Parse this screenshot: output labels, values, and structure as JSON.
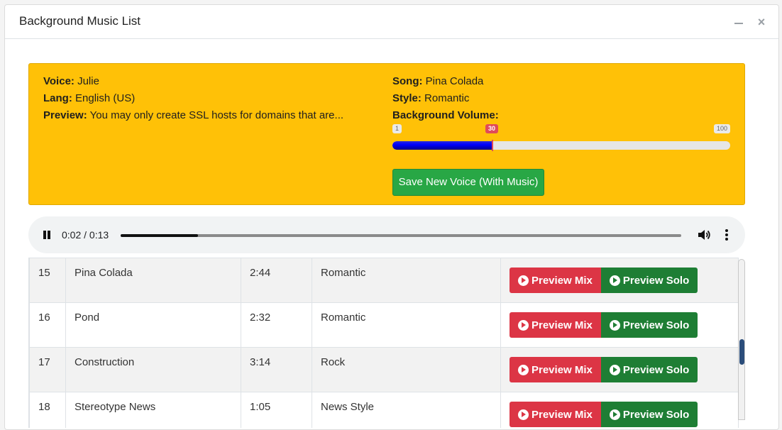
{
  "modal": {
    "title": "Background Music List",
    "close_glyph": "×"
  },
  "voice_info": {
    "voice_label": "Voice:",
    "voice": "Julie",
    "lang_label": "Lang:",
    "lang": "English (US)",
    "preview_label": "Preview:",
    "preview": "You may only create SSL hosts for domains that are..."
  },
  "song_info": {
    "song_label": "Song:",
    "song": "Pina Colada",
    "style_label": "Style:",
    "style": "Romantic",
    "volume_label": "Background Volume:"
  },
  "volume_slider": {
    "min": "1",
    "max": "100",
    "value": "30",
    "value_num": 30,
    "min_num": 1,
    "max_num": 100
  },
  "save_button": "Save New Voice (With Music)",
  "audio_player": {
    "time": "0:02 / 0:13",
    "current_seconds": 2,
    "duration_seconds": 13
  },
  "table": {
    "rows": [
      {
        "id": "15",
        "name": "Pina Colada",
        "duration": "2:44",
        "style": "Romantic"
      },
      {
        "id": "16",
        "name": "Pond",
        "duration": "2:32",
        "style": "Romantic"
      },
      {
        "id": "17",
        "name": "Construction",
        "duration": "3:14",
        "style": "Rock"
      },
      {
        "id": "18",
        "name": "Stereotype News",
        "duration": "1:05",
        "style": "News Style"
      }
    ],
    "preview_mix_label": "Preview Mix",
    "preview_solo_label": "Preview Solo"
  },
  "colors": {
    "panel": "#ffc107",
    "save": "#28a745",
    "mix": "#dc3545",
    "solo": "#1e7e34",
    "slider_value": "#e04a5a"
  }
}
